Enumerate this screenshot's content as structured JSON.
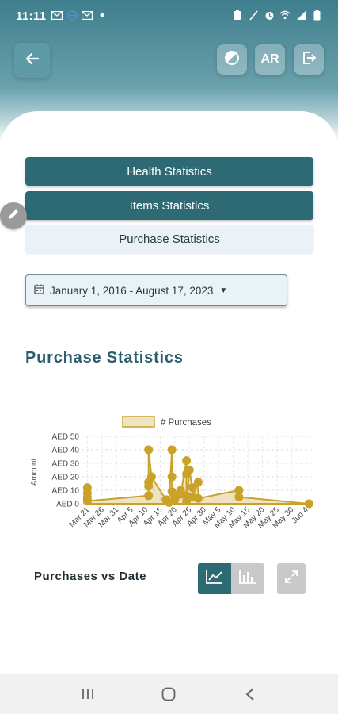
{
  "status_bar": {
    "time": "11:11",
    "left_icons": [
      "gmail-icon",
      "vpn-icon",
      "gmail-icon",
      "dot-icon"
    ],
    "right_icons": [
      "battery-saver-icon",
      "signal-off-icon",
      "alarm-icon",
      "wifi-icon",
      "signal-icon",
      "battery-icon"
    ]
  },
  "header": {
    "back_icon": "arrow-left-icon",
    "theme_icon": "contrast-icon",
    "lang_label": "AR",
    "logout_icon": "logout-icon"
  },
  "menu": {
    "items": [
      {
        "label": "Health Statistics",
        "active": false
      },
      {
        "label": "Items Statistics",
        "active": false
      },
      {
        "label": "Purchase Statistics",
        "active": true
      }
    ]
  },
  "date_range": {
    "icon": "calendar-icon",
    "value": "January 1, 2016 - August 17, 2023"
  },
  "section": {
    "title": "Purchase Statistics"
  },
  "chart_data": {
    "type": "area",
    "legend": "# Purchases",
    "legend_position": "top",
    "ylabel": "Amount",
    "y_ticks": [
      "AED 0",
      "AED 10",
      "AED 20",
      "AED 30",
      "AED 40",
      "AED 50"
    ],
    "ylim": [
      0,
      50
    ],
    "x_ticks": [
      "Mar 21",
      "Mar 26",
      "Mar 31",
      "Apr 5",
      "Apr 10",
      "Apr 15",
      "Apr 20",
      "Apr 25",
      "Apr 30",
      "May 5",
      "May 10",
      "May 15",
      "May 20",
      "May 25",
      "May 30",
      "Jun 4"
    ],
    "x_start": "Mar 19",
    "x_end": "Jun 6",
    "grid": true,
    "color": "#c9a227",
    "fill": "rgba(210,175,80,0.35)",
    "points": [
      {
        "x": "Mar 21",
        "y": 12
      },
      {
        "x": "Mar 21",
        "y": 8
      },
      {
        "x": "Mar 21",
        "y": 5
      },
      {
        "x": "Mar 21",
        "y": 3
      },
      {
        "x": "Mar 21",
        "y": 2
      },
      {
        "x": "Apr 11",
        "y": 6
      },
      {
        "x": "Apr 11",
        "y": 13
      },
      {
        "x": "Apr 11",
        "y": 16
      },
      {
        "x": "Apr 11",
        "y": 40
      },
      {
        "x": "Apr 12",
        "y": 20
      },
      {
        "x": "Apr 17",
        "y": 3
      },
      {
        "x": "Apr 18",
        "y": 1
      },
      {
        "x": "Apr 19",
        "y": 40
      },
      {
        "x": "Apr 19",
        "y": 20
      },
      {
        "x": "Apr 19",
        "y": 9
      },
      {
        "x": "Apr 20",
        "y": 6
      },
      {
        "x": "Apr 20",
        "y": 3
      },
      {
        "x": "Apr 22",
        "y": 10
      },
      {
        "x": "Apr 22",
        "y": 7
      },
      {
        "x": "Apr 24",
        "y": 32
      },
      {
        "x": "Apr 24",
        "y": 22
      },
      {
        "x": "Apr 24",
        "y": 6
      },
      {
        "x": "Apr 24",
        "y": 2
      },
      {
        "x": "Apr 25",
        "y": 25
      },
      {
        "x": "Apr 26",
        "y": 12
      },
      {
        "x": "Apr 26",
        "y": 5
      },
      {
        "x": "Apr 28",
        "y": 16
      },
      {
        "x": "Apr 28",
        "y": 4
      },
      {
        "x": "May 12",
        "y": 10
      },
      {
        "x": "May 12",
        "y": 5
      },
      {
        "x": "Jun 5",
        "y": 0
      }
    ]
  },
  "chart_footer": {
    "caption": "Purchases vs Date",
    "line_icon": "line-chart-icon",
    "bar_icon": "bar-chart-icon",
    "expand_icon": "expand-icon"
  },
  "nav_bar": {
    "items": [
      "recent-apps-icon",
      "home-icon",
      "back-icon"
    ]
  },
  "colors": {
    "primary": "#2e6a74",
    "accent": "#c9a227",
    "title": "#2c5f6e",
    "light": "#e9f2f7"
  }
}
